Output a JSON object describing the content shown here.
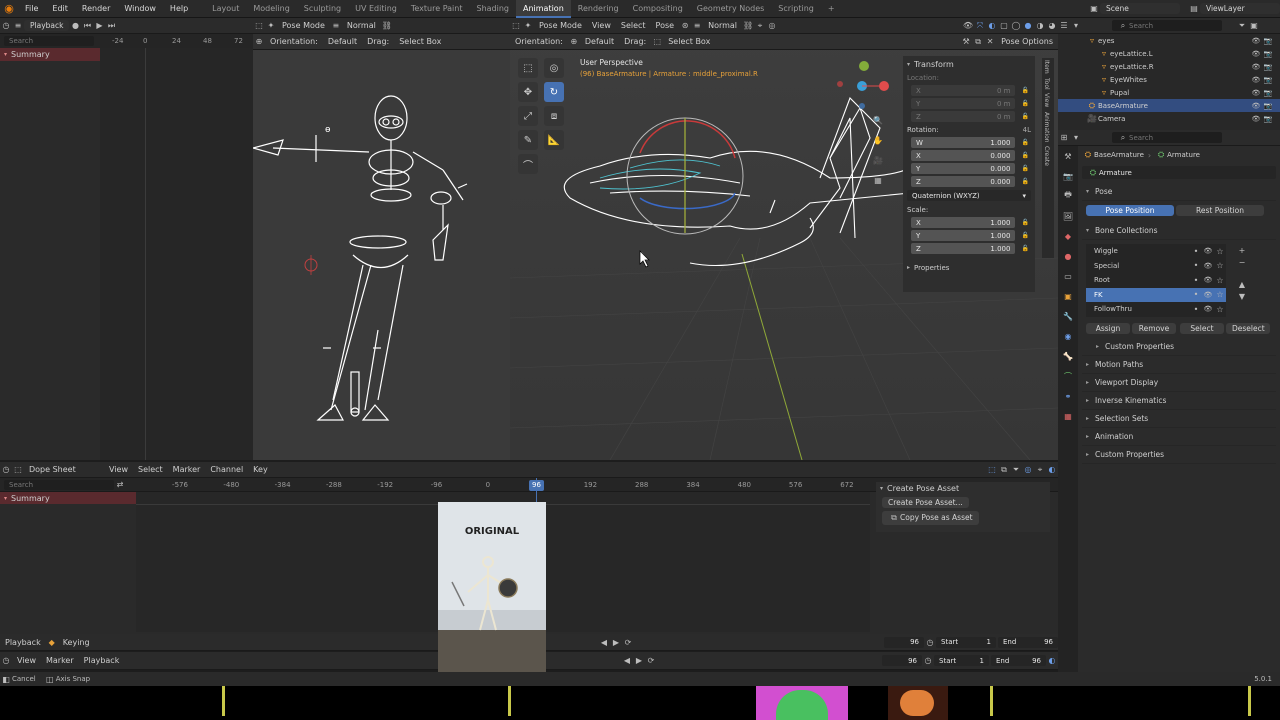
{
  "menu": {
    "items": [
      "File",
      "Edit",
      "Render",
      "Window",
      "Help"
    ]
  },
  "workspaces": [
    "Layout",
    "Modeling",
    "Sculpting",
    "UV Editing",
    "Texture Paint",
    "Shading",
    "Animation",
    "Rendering",
    "Compositing",
    "Geometry Nodes",
    "Scripting"
  ],
  "active_workspace": "Animation",
  "scene": {
    "label": "Scene",
    "viewlayer": "ViewLayer"
  },
  "left_editor": {
    "playback": "Playback",
    "search_placeholder": "Search",
    "summary": "Summary",
    "ruler": [
      "-24",
      "0",
      "24",
      "48",
      "72"
    ]
  },
  "left_viewport": {
    "mode": "Pose Mode",
    "shading": "Normal",
    "orientation_label": "Orientation:",
    "orientation_value": "Default",
    "drag_label": "Drag:",
    "drag_value": "Select Box"
  },
  "main_viewport": {
    "orientation_label": "Orientation:",
    "orientation_value": "Default",
    "drag_label": "Drag:",
    "drag_value": "Select Box",
    "mode": "Pose Mode",
    "menus": [
      "View",
      "Select",
      "Pose"
    ],
    "shading": "Normal",
    "pose_options": "Pose Options",
    "view_name": "User Perspective",
    "view_info": "(96) BaseArmature | Armature : middle_proximal.R"
  },
  "transform_panel": {
    "title": "Transform",
    "location_label": "Location:",
    "location": [
      {
        "axis": "X",
        "value": "0 m"
      },
      {
        "axis": "Y",
        "value": "0 m"
      },
      {
        "axis": "Z",
        "value": "0 m"
      }
    ],
    "rotation_label": "Rotation:",
    "rotation_marker": "4L",
    "rotation": [
      {
        "axis": "W",
        "value": "1.000"
      },
      {
        "axis": "X",
        "value": "0.000"
      },
      {
        "axis": "Y",
        "value": "0.000"
      },
      {
        "axis": "Z",
        "value": "0.000"
      }
    ],
    "rotation_mode": "Quaternion (WXYZ)",
    "scale_label": "Scale:",
    "scale": [
      {
        "axis": "X",
        "value": "1.000"
      },
      {
        "axis": "Y",
        "value": "1.000"
      },
      {
        "axis": "Z",
        "value": "1.000"
      }
    ],
    "properties": "Properties"
  },
  "side_tabs": [
    "Item",
    "Tool",
    "View",
    "Animation",
    "Create"
  ],
  "outliner": {
    "search_placeholder": "Search",
    "rows": [
      {
        "name": "eyes",
        "indent": 1,
        "selected": false
      },
      {
        "name": "eyeLattice.L",
        "indent": 2,
        "selected": false
      },
      {
        "name": "eyeLattice.R",
        "indent": 2,
        "selected": false
      },
      {
        "name": "EyeWhites",
        "indent": 2,
        "selected": false
      },
      {
        "name": "Pupal",
        "indent": 2,
        "selected": false
      },
      {
        "name": "BaseArmature",
        "indent": 1,
        "selected": true
      },
      {
        "name": "Camera",
        "indent": 1,
        "selected": false
      }
    ]
  },
  "properties": {
    "search_placeholder": "Search",
    "breadcrumb_object": "BaseArmature",
    "breadcrumb_data": "Armature",
    "data_name": "Armature",
    "pose_section": "Pose",
    "pose_position": "Pose Position",
    "rest_position": "Rest Position",
    "bone_collections_section": "Bone Collections",
    "bone_collections": [
      {
        "name": "Wiggle",
        "selected": false
      },
      {
        "name": "Special",
        "selected": false
      },
      {
        "name": "Root",
        "selected": false
      },
      {
        "name": "FK",
        "selected": true
      },
      {
        "name": "FollowThru",
        "selected": false
      }
    ],
    "assign": "Assign",
    "remove": "Remove",
    "select": "Select",
    "deselect": "Deselect",
    "sections": [
      "Custom Properties",
      "Motion Paths",
      "Viewport Display",
      "Inverse Kinematics",
      "Selection Sets",
      "Animation",
      "Custom Properties"
    ]
  },
  "dopesheet": {
    "editor": "Dope Sheet",
    "menus": [
      "View",
      "Select",
      "Marker",
      "Channel",
      "Key"
    ],
    "search_placeholder": "Search",
    "summary": "Summary",
    "ruler": [
      "-576",
      "-480",
      "-384",
      "-288",
      "-192",
      "-96",
      "0",
      "96",
      "192",
      "288",
      "384",
      "480",
      "576",
      "672"
    ],
    "current_frame": "96",
    "create_pose_panel": "Create Pose Asset",
    "create_pose_asset": "Create Pose Asset...",
    "copy_pose_asset": "Copy Pose as Asset"
  },
  "overlay_video": {
    "label": "ORIGINAL"
  },
  "timeline1": {
    "playback": "Playback",
    "keying": "Keying",
    "frame": "96",
    "start_label": "Start",
    "start": "1",
    "end_label": "End",
    "end": "96"
  },
  "timeline2": {
    "menus": [
      "View",
      "Marker",
      "Playback"
    ],
    "frame": "96",
    "start_label": "Start",
    "start": "1",
    "end_label": "End",
    "end": "96"
  },
  "status": {
    "cancel": "Cancel",
    "axis_snap": "Axis Snap",
    "version": "5.0.1"
  },
  "colors": {
    "accent": "#4772b3",
    "orange": "#e87d0d",
    "summary_red": "#5a2a2e"
  }
}
